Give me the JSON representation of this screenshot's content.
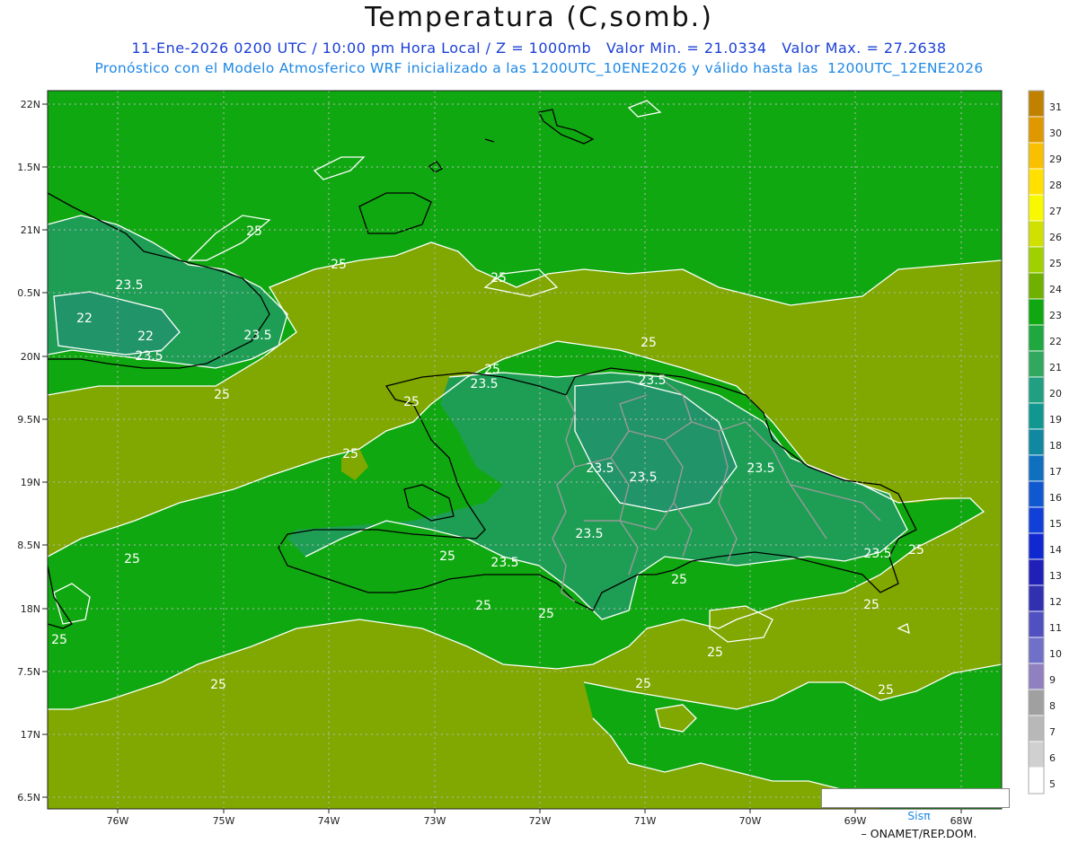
{
  "header": {
    "title": "Temperatura (C,somb.)",
    "line1": "11-Ene-2026 0200 UTC / 10:00 pm Hora Local / Z = 1000mb   Valor Min. = 21.0334   Valor Max. = 27.2638",
    "line2": "Pronóstico con el Modelo Atmosferico WRF inicializado a las 1200UTC_10ENE2026 y válido hasta las  1200UTC_12ENE2026"
  },
  "map": {
    "lat_labels": [
      "22N",
      "1.5N",
      "21N",
      "0.5N",
      "20N",
      "9.5N",
      "19N",
      "8.5N",
      "18N",
      "7.5N",
      "17N",
      "6.5N"
    ],
    "lon_labels": [
      "76W",
      "75W",
      "74W",
      "73W",
      "72W",
      "71W",
      "70W",
      "69W",
      "68W"
    ],
    "contour_labels": [
      "25",
      "25",
      "25",
      "25",
      "25",
      "25",
      "25",
      "25",
      "25",
      "25",
      "25",
      "25",
      "25",
      "25",
      "25",
      "25",
      "25",
      "25",
      "25",
      "25",
      "23.5",
      "23.5",
      "23.5",
      "23.5",
      "23.5",
      "23.5",
      "23.5",
      "23.5",
      "23.5",
      "23.5",
      "23.5",
      "22",
      "22"
    ],
    "colors": {
      "sea_warm": "#80a800",
      "land_24": "#10a810",
      "cool_23": "#19a835",
      "cool_22": "#1e9e55",
      "contour": "#ffffff",
      "coast": "#000000",
      "border": "#999999"
    }
  },
  "colorbar": {
    "levels": [
      "31",
      "30",
      "29",
      "28",
      "27",
      "26",
      "25",
      "24",
      "23",
      "22",
      "21",
      "20",
      "19",
      "18",
      "17",
      "16",
      "15",
      "14",
      "13",
      "12",
      "11",
      "10",
      "9",
      "8",
      "7",
      "6",
      "5"
    ],
    "colors": [
      "#c08000",
      "#e09800",
      "#f8c000",
      "#ffe000",
      "#f8f800",
      "#d0e000",
      "#a0d000",
      "#70b000",
      "#10a810",
      "#20a840",
      "#30a860",
      "#20a080",
      "#109890",
      "#1088a0",
      "#1070c0",
      "#1058d0",
      "#1040d8",
      "#1028d0",
      "#2020b8",
      "#3030b0",
      "#5050c0",
      "#7070c8",
      "#9080c0",
      "#a0a0a0",
      "#b8b8b8",
      "#d0d0d0",
      "#ffffff"
    ]
  },
  "credit": {
    "logo": "Sisπ",
    "text": "– ONAMET/REP.DOM."
  }
}
